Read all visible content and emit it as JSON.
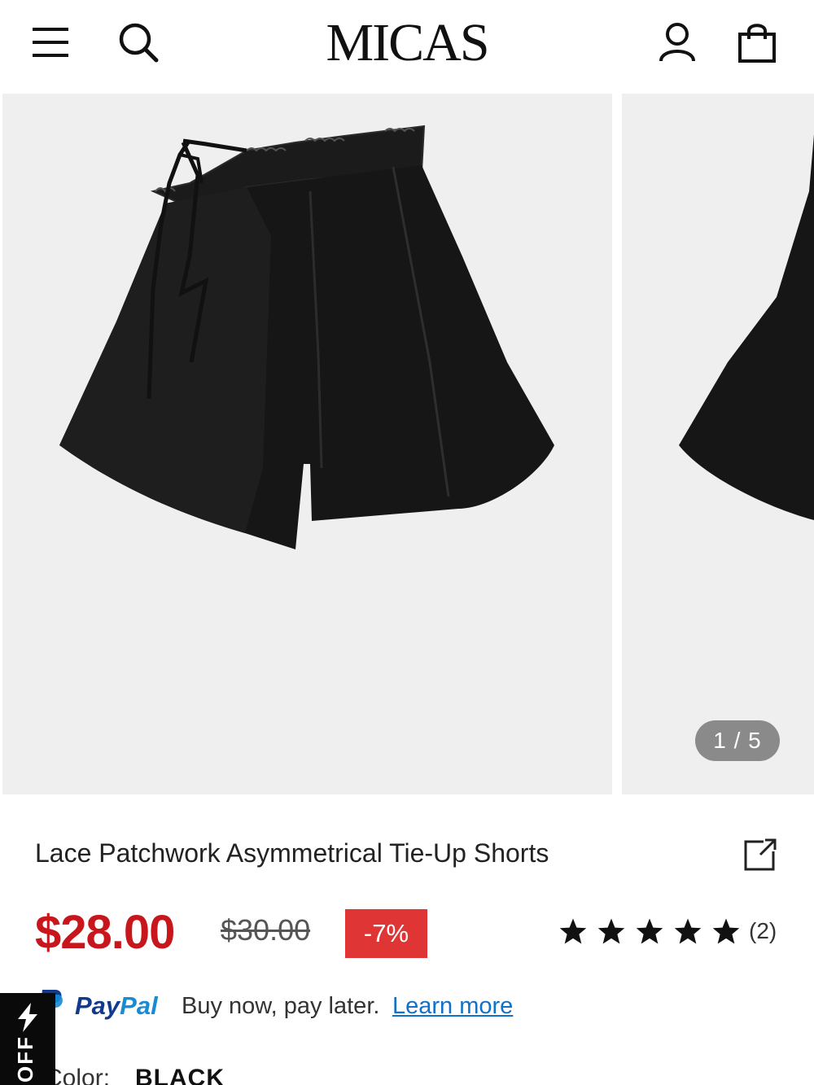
{
  "header": {
    "logo": "MICAS",
    "icons": [
      "menu-icon",
      "search-icon",
      "account-icon",
      "bag-icon"
    ]
  },
  "gallery": {
    "counter": "1 / 5",
    "current": 1,
    "total": 5
  },
  "product": {
    "title": "Lace Patchwork Asymmetrical Tie-Up Shorts",
    "price": "$28.00",
    "old_price": "$30.00",
    "discount": "-7%",
    "rating": 5,
    "reviews": "(2)"
  },
  "paypal": {
    "word_pay": "Pay",
    "word_pal": "Pal",
    "message": "Buy now, pay later.",
    "link": "Learn more"
  },
  "color": {
    "label": "Color:",
    "value": "BLACK"
  },
  "promo_tab": {
    "label": "OFF"
  },
  "colors": {
    "price_red": "#c8161d",
    "discount_bg": "#e03535",
    "paypal_dark": "#123a8c",
    "paypal_light": "#1a8ad3",
    "link_blue": "#1170c8"
  }
}
